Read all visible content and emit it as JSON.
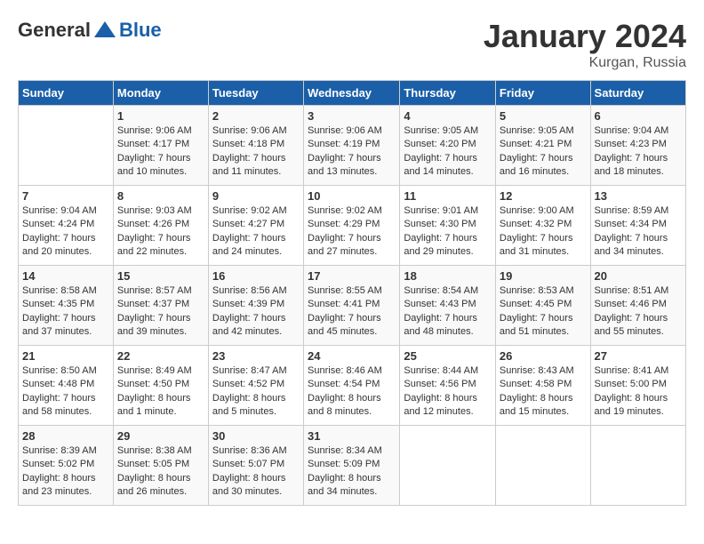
{
  "logo": {
    "general": "General",
    "blue": "Blue"
  },
  "title": "January 2024",
  "subtitle": "Kurgan, Russia",
  "days_of_week": [
    "Sunday",
    "Monday",
    "Tuesday",
    "Wednesday",
    "Thursday",
    "Friday",
    "Saturday"
  ],
  "weeks": [
    [
      {
        "day": "",
        "sunrise": "",
        "sunset": "",
        "daylight": ""
      },
      {
        "day": "1",
        "sunrise": "Sunrise: 9:06 AM",
        "sunset": "Sunset: 4:17 PM",
        "daylight": "Daylight: 7 hours and 10 minutes."
      },
      {
        "day": "2",
        "sunrise": "Sunrise: 9:06 AM",
        "sunset": "Sunset: 4:18 PM",
        "daylight": "Daylight: 7 hours and 11 minutes."
      },
      {
        "day": "3",
        "sunrise": "Sunrise: 9:06 AM",
        "sunset": "Sunset: 4:19 PM",
        "daylight": "Daylight: 7 hours and 13 minutes."
      },
      {
        "day": "4",
        "sunrise": "Sunrise: 9:05 AM",
        "sunset": "Sunset: 4:20 PM",
        "daylight": "Daylight: 7 hours and 14 minutes."
      },
      {
        "day": "5",
        "sunrise": "Sunrise: 9:05 AM",
        "sunset": "Sunset: 4:21 PM",
        "daylight": "Daylight: 7 hours and 16 minutes."
      },
      {
        "day": "6",
        "sunrise": "Sunrise: 9:04 AM",
        "sunset": "Sunset: 4:23 PM",
        "daylight": "Daylight: 7 hours and 18 minutes."
      }
    ],
    [
      {
        "day": "7",
        "sunrise": "Sunrise: 9:04 AM",
        "sunset": "Sunset: 4:24 PM",
        "daylight": "Daylight: 7 hours and 20 minutes."
      },
      {
        "day": "8",
        "sunrise": "Sunrise: 9:03 AM",
        "sunset": "Sunset: 4:26 PM",
        "daylight": "Daylight: 7 hours and 22 minutes."
      },
      {
        "day": "9",
        "sunrise": "Sunrise: 9:02 AM",
        "sunset": "Sunset: 4:27 PM",
        "daylight": "Daylight: 7 hours and 24 minutes."
      },
      {
        "day": "10",
        "sunrise": "Sunrise: 9:02 AM",
        "sunset": "Sunset: 4:29 PM",
        "daylight": "Daylight: 7 hours and 27 minutes."
      },
      {
        "day": "11",
        "sunrise": "Sunrise: 9:01 AM",
        "sunset": "Sunset: 4:30 PM",
        "daylight": "Daylight: 7 hours and 29 minutes."
      },
      {
        "day": "12",
        "sunrise": "Sunrise: 9:00 AM",
        "sunset": "Sunset: 4:32 PM",
        "daylight": "Daylight: 7 hours and 31 minutes."
      },
      {
        "day": "13",
        "sunrise": "Sunrise: 8:59 AM",
        "sunset": "Sunset: 4:34 PM",
        "daylight": "Daylight: 7 hours and 34 minutes."
      }
    ],
    [
      {
        "day": "14",
        "sunrise": "Sunrise: 8:58 AM",
        "sunset": "Sunset: 4:35 PM",
        "daylight": "Daylight: 7 hours and 37 minutes."
      },
      {
        "day": "15",
        "sunrise": "Sunrise: 8:57 AM",
        "sunset": "Sunset: 4:37 PM",
        "daylight": "Daylight: 7 hours and 39 minutes."
      },
      {
        "day": "16",
        "sunrise": "Sunrise: 8:56 AM",
        "sunset": "Sunset: 4:39 PM",
        "daylight": "Daylight: 7 hours and 42 minutes."
      },
      {
        "day": "17",
        "sunrise": "Sunrise: 8:55 AM",
        "sunset": "Sunset: 4:41 PM",
        "daylight": "Daylight: 7 hours and 45 minutes."
      },
      {
        "day": "18",
        "sunrise": "Sunrise: 8:54 AM",
        "sunset": "Sunset: 4:43 PM",
        "daylight": "Daylight: 7 hours and 48 minutes."
      },
      {
        "day": "19",
        "sunrise": "Sunrise: 8:53 AM",
        "sunset": "Sunset: 4:45 PM",
        "daylight": "Daylight: 7 hours and 51 minutes."
      },
      {
        "day": "20",
        "sunrise": "Sunrise: 8:51 AM",
        "sunset": "Sunset: 4:46 PM",
        "daylight": "Daylight: 7 hours and 55 minutes."
      }
    ],
    [
      {
        "day": "21",
        "sunrise": "Sunrise: 8:50 AM",
        "sunset": "Sunset: 4:48 PM",
        "daylight": "Daylight: 7 hours and 58 minutes."
      },
      {
        "day": "22",
        "sunrise": "Sunrise: 8:49 AM",
        "sunset": "Sunset: 4:50 PM",
        "daylight": "Daylight: 8 hours and 1 minute."
      },
      {
        "day": "23",
        "sunrise": "Sunrise: 8:47 AM",
        "sunset": "Sunset: 4:52 PM",
        "daylight": "Daylight: 8 hours and 5 minutes."
      },
      {
        "day": "24",
        "sunrise": "Sunrise: 8:46 AM",
        "sunset": "Sunset: 4:54 PM",
        "daylight": "Daylight: 8 hours and 8 minutes."
      },
      {
        "day": "25",
        "sunrise": "Sunrise: 8:44 AM",
        "sunset": "Sunset: 4:56 PM",
        "daylight": "Daylight: 8 hours and 12 minutes."
      },
      {
        "day": "26",
        "sunrise": "Sunrise: 8:43 AM",
        "sunset": "Sunset: 4:58 PM",
        "daylight": "Daylight: 8 hours and 15 minutes."
      },
      {
        "day": "27",
        "sunrise": "Sunrise: 8:41 AM",
        "sunset": "Sunset: 5:00 PM",
        "daylight": "Daylight: 8 hours and 19 minutes."
      }
    ],
    [
      {
        "day": "28",
        "sunrise": "Sunrise: 8:39 AM",
        "sunset": "Sunset: 5:02 PM",
        "daylight": "Daylight: 8 hours and 23 minutes."
      },
      {
        "day": "29",
        "sunrise": "Sunrise: 8:38 AM",
        "sunset": "Sunset: 5:05 PM",
        "daylight": "Daylight: 8 hours and 26 minutes."
      },
      {
        "day": "30",
        "sunrise": "Sunrise: 8:36 AM",
        "sunset": "Sunset: 5:07 PM",
        "daylight": "Daylight: 8 hours and 30 minutes."
      },
      {
        "day": "31",
        "sunrise": "Sunrise: 8:34 AM",
        "sunset": "Sunset: 5:09 PM",
        "daylight": "Daylight: 8 hours and 34 minutes."
      },
      {
        "day": "",
        "sunrise": "",
        "sunset": "",
        "daylight": ""
      },
      {
        "day": "",
        "sunrise": "",
        "sunset": "",
        "daylight": ""
      },
      {
        "day": "",
        "sunrise": "",
        "sunset": "",
        "daylight": ""
      }
    ]
  ]
}
